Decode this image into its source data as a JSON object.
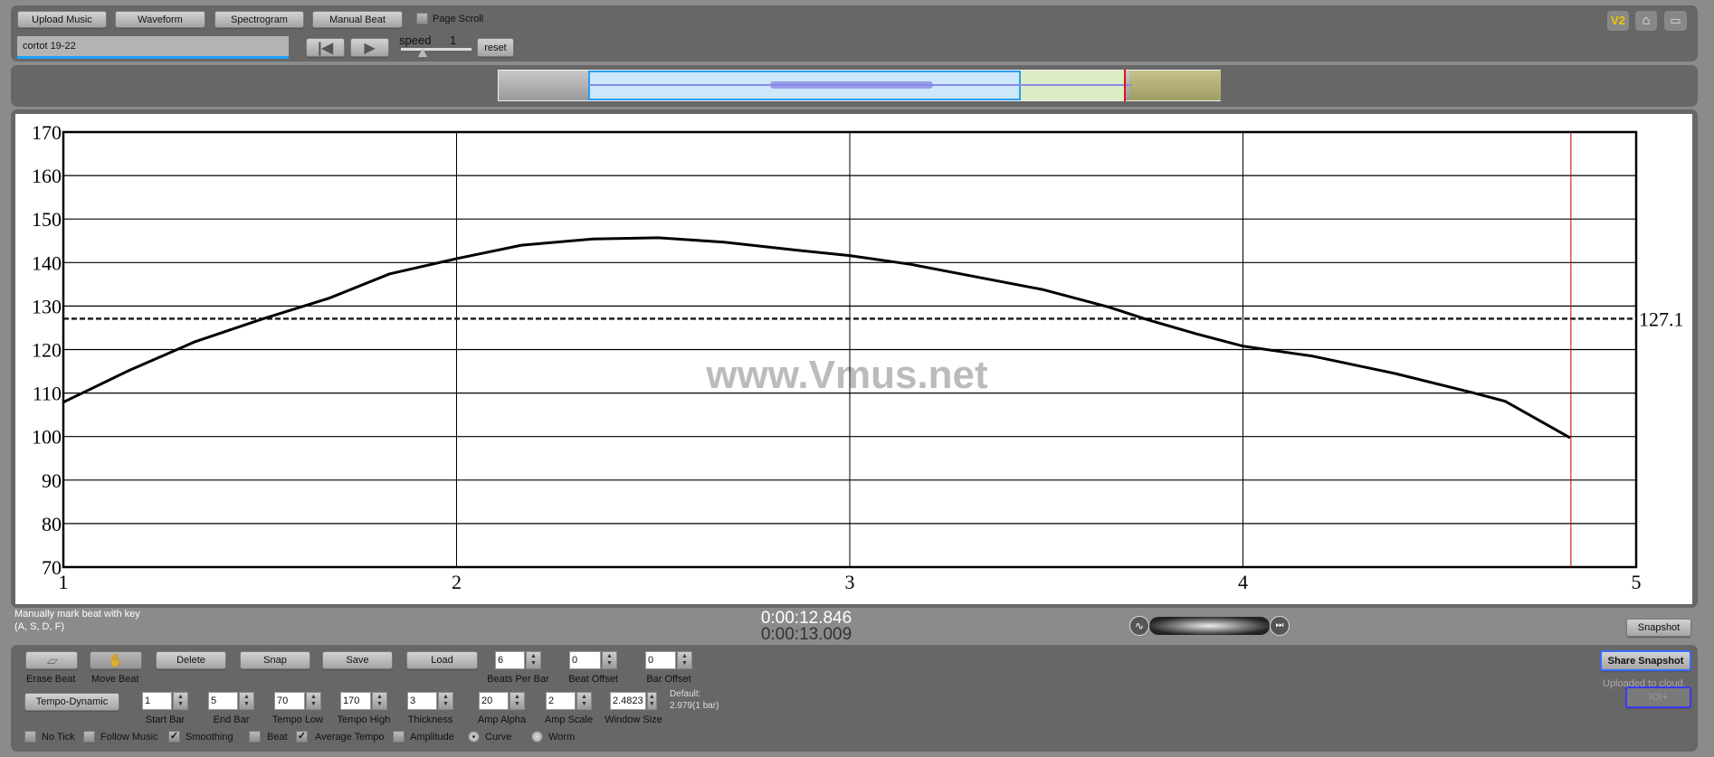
{
  "toolbar": {
    "upload_label": "Upload Music",
    "waveform_label": "Waveform",
    "spectrogram_label": "Spectrogram",
    "manual_beat_label": "Manual Beat",
    "page_scroll_label": "Page Scroll",
    "page_scroll_checked": false,
    "file_name": "cortot 19-22",
    "speed_label": "speed",
    "speed_value": "1",
    "reset_label": "reset",
    "icons": [
      "v2-icon",
      "home-icon",
      "fullscreen-icon"
    ],
    "v2_text": "V2"
  },
  "waveform_overview": {
    "colors": {
      "selected": "#cde8fb",
      "played": "#dcecc4",
      "rest": "#a8a670",
      "wave": "#8a8ae6",
      "playhead": "#e01010"
    }
  },
  "chart_data": {
    "type": "line",
    "xlim": [
      1,
      5
    ],
    "ylim": [
      70,
      170
    ],
    "x_ticks": [
      "1",
      "2",
      "3",
      "4",
      "5"
    ],
    "y_ticks": [
      "70",
      "80",
      "90",
      "100",
      "110",
      "120",
      "130",
      "140",
      "150",
      "160",
      "170"
    ],
    "grid": true,
    "series": [
      {
        "x": [
          1.0,
          1.167,
          1.335,
          1.509,
          1.676,
          1.83,
          2.0,
          2.165,
          2.346,
          2.513,
          2.68,
          2.86,
          3.0,
          3.154,
          3.49,
          3.658,
          3.756,
          3.882,
          4.0,
          4.176,
          4.387,
          4.583,
          4.667,
          4.832
        ],
        "y": [
          107.9,
          115.2,
          121.8,
          127.1,
          131.8,
          137.4,
          140.9,
          144.0,
          145.4,
          145.7,
          144.7,
          142.9,
          141.6,
          139.6,
          133.8,
          129.8,
          126.9,
          123.6,
          120.8,
          118.5,
          114.5,
          110.1,
          108.1,
          99.7
        ],
        "color": "#000000"
      }
    ],
    "average_line": {
      "value": 127.1,
      "label": "127.1",
      "style": "dashed"
    },
    "cursor_x": 4.834,
    "cursor_color": "#cc0000",
    "watermark": "www.Vmus.net"
  },
  "status": {
    "hint_line1": "Manually mark beat with key",
    "hint_line2": "(A, S, D, F)",
    "time_current": "0:00:12.846",
    "time_total": "0:00:13.009",
    "snapshot_label": "Snapshot"
  },
  "controls": {
    "erase_label": "Erase Beat",
    "move_label": "Move Beat",
    "delete_label": "Delete",
    "snap_label": "Snap",
    "save_label": "Save",
    "load_label": "Load",
    "beats_per_bar": {
      "label": "Beats Per Bar",
      "value": "6"
    },
    "beat_offset": {
      "label": "Beat Offset",
      "value": "0"
    },
    "bar_offset": {
      "label": "Bar Offset",
      "value": "0"
    },
    "tempo_dynamic_label": "Tempo-Dynamic",
    "start_bar": {
      "label": "Start Bar",
      "value": "1"
    },
    "end_bar": {
      "label": "End Bar",
      "value": "5"
    },
    "tempo_low": {
      "label": "Tempo Low",
      "value": "70"
    },
    "tempo_high": {
      "label": "Tempo High",
      "value": "170"
    },
    "thickness": {
      "label": "Thickness",
      "value": "3"
    },
    "amp_alpha": {
      "label": "Amp Alpha",
      "value": "20"
    },
    "amp_scale": {
      "label": "Amp Scale",
      "value": "2"
    },
    "window_size": {
      "label": "Window Size",
      "value": "2.4823"
    },
    "default_line1": "Default:",
    "default_line2": "2.979(1 bar)",
    "no_tick": "No Tick",
    "follow_music": "Follow Music",
    "smoothing": "Smoothing",
    "beat": "Beat",
    "average_tempo": "Average Tempo",
    "amplitude": "Amplitude",
    "curve": "Curve",
    "worm": "Worm",
    "check_mark": "✓",
    "share_label": "Share Snapshot",
    "uploaded_label": "Uploaded to cloud.",
    "ioi_label": "IOI+"
  }
}
